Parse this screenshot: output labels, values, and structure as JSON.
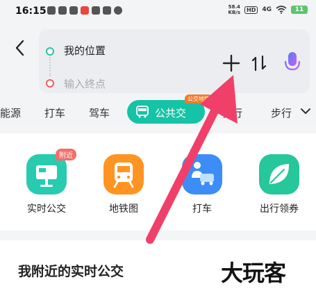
{
  "status_bar": {
    "time": "16:15",
    "speed_value": "58.4",
    "speed_unit": "KB/s",
    "hd": "HD",
    "network": "4G",
    "battery": "11"
  },
  "search": {
    "origin": "我的位置",
    "destination_placeholder": "输入终点"
  },
  "tabs": {
    "items": [
      "能源",
      "打车",
      "驾车",
      "公共交",
      "骑行",
      "步行"
    ],
    "active_label": "公共交",
    "active_badge": "公交地铁"
  },
  "quick_actions": {
    "items": [
      {
        "label": "实时公交",
        "badge": "附近"
      },
      {
        "label": "地铁图"
      },
      {
        "label": "打车"
      },
      {
        "label": "出行领券"
      }
    ]
  },
  "nearby": {
    "title": "我附近的实时公交"
  },
  "watermark": "大玩客",
  "colors": {
    "accent": "#15c3a6",
    "arrow": "#f0406a"
  }
}
